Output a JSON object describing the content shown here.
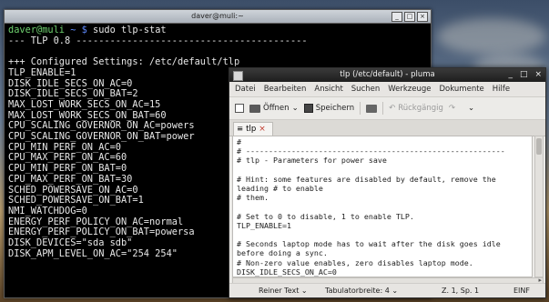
{
  "terminal": {
    "title": "daver@muli:~",
    "prompt_user": "daver@muli",
    "prompt_path": "~ $",
    "command": "sudo tlp-stat",
    "lines": [
      "--- TLP 0.8 -----------------------------------------",
      "",
      "+++ Configured Settings: /etc/default/tlp",
      "TLP_ENABLE=1",
      "DISK_IDLE_SECS_ON_AC=0",
      "DISK_IDLE_SECS_ON_BAT=2",
      "MAX_LOST_WORK_SECS_ON_AC=15",
      "MAX_LOST_WORK_SECS_ON_BAT=60",
      "CPU_SCALING_GOVERNOR_ON_AC=powers",
      "CPU_SCALING_GOVERNOR_ON_BAT=power",
      "CPU_MIN_PERF_ON_AC=0",
      "CPU_MAX_PERF_ON_AC=60",
      "CPU_MIN_PERF_ON_BAT=0",
      "CPU_MAX_PERF_ON_BAT=30",
      "SCHED_POWERSAVE_ON_AC=0",
      "SCHED_POWERSAVE_ON_BAT=1",
      "NMI_WATCHDOG=0",
      "ENERGY_PERF_POLICY_ON_AC=normal",
      "ENERGY_PERF_POLICY_ON_BAT=powersa",
      "DISK_DEVICES=\"sda sdb\"",
      "DISK_APM_LEVEL_ON_AC=\"254 254\""
    ]
  },
  "pluma": {
    "title": "tlp (/etc/default) - pluma",
    "window_buttons": [
      "_",
      "□",
      "×"
    ],
    "menu": [
      "Datei",
      "Bearbeiten",
      "Ansicht",
      "Suchen",
      "Werkzeuge",
      "Dokumente",
      "Hilfe"
    ],
    "toolbar": {
      "open_label": "Öffnen",
      "save_label": "Speichern",
      "undo_label": "Rückgängig"
    },
    "tab_label": "tlp",
    "editor_lines": [
      "#",
      "# ---------------------------------------------------------",
      "# tlp - Parameters for power save",
      "",
      "# Hint: some features are disabled by default, remove the",
      "leading # to enable",
      "# them.",
      "",
      "# Set to 0 to disable, 1 to enable TLP.",
      "TLP_ENABLE=1",
      "",
      "# Seconds laptop mode has to wait after the disk goes idle",
      "before doing a sync.",
      "# Non-zero value enables, zero disables laptop mode.",
      "DISK_IDLE_SECS_ON_AC=0"
    ],
    "status": {
      "syntax": "Reiner Text",
      "tab_width": "Tabulatorbreite: 4",
      "position": "Z. 1, Sp. 1",
      "mode": "EINF"
    }
  }
}
